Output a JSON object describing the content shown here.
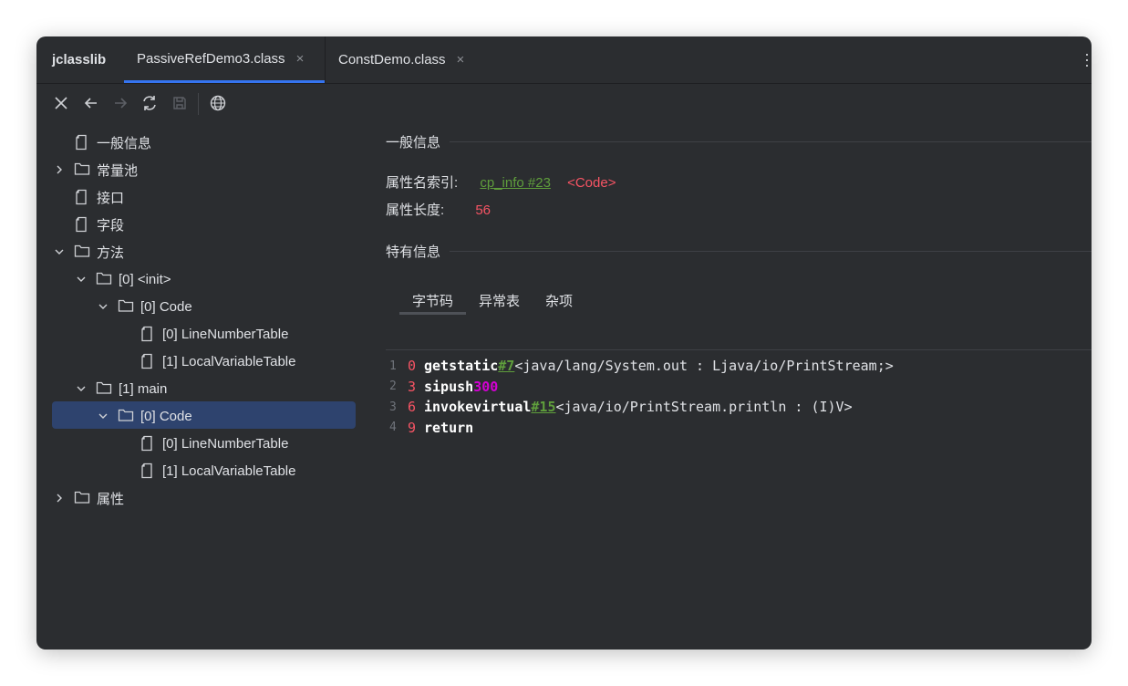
{
  "app": {
    "title": "jclasslib"
  },
  "tabs": [
    {
      "label": "PassiveRefDemo3.class",
      "close": "×",
      "active": true
    },
    {
      "label": "ConstDemo.class",
      "close": "×",
      "active": false
    }
  ],
  "toolbar": {
    "buttons": [
      "close-icon",
      "back-arrow-icon",
      "forward-arrow-icon",
      "refresh-icon",
      "save-icon",
      "globe-icon"
    ]
  },
  "tree": [
    {
      "label": "一般信息",
      "icon": "file-icon",
      "expanded": null
    },
    {
      "label": "常量池",
      "icon": "folder-icon",
      "expanded": false
    },
    {
      "label": "接口",
      "icon": "file-icon",
      "expanded": null
    },
    {
      "label": "字段",
      "icon": "file-icon",
      "expanded": null
    },
    {
      "label": "方法",
      "icon": "folder-icon",
      "expanded": true
    },
    {
      "label": "[0] <init>",
      "icon": "folder-icon",
      "expanded": true
    },
    {
      "label": "[0] Code",
      "icon": "folder-icon",
      "expanded": true
    },
    {
      "label": "[0] LineNumberTable",
      "icon": "file-icon",
      "expanded": null
    },
    {
      "label": "[1] LocalVariableTable",
      "icon": "file-icon",
      "expanded": null
    },
    {
      "label": "[1] main",
      "icon": "folder-icon",
      "expanded": true
    },
    {
      "label": "[0] Code",
      "icon": "folder-icon",
      "expanded": true,
      "selected": true
    },
    {
      "label": "[0] LineNumberTable",
      "icon": "file-icon",
      "expanded": null
    },
    {
      "label": "[1] LocalVariableTable",
      "icon": "file-icon",
      "expanded": null
    },
    {
      "label": "属性",
      "icon": "folder-icon",
      "expanded": false
    }
  ],
  "detail": {
    "general_title": "一般信息",
    "attr_name_label": "属性名索引:",
    "attr_name_link": "cp_info #23",
    "attr_name_value": "<Code>",
    "attr_len_label": "属性长度:",
    "attr_len_value": "56",
    "specific_title": "特有信息",
    "subtabs": [
      "字节码",
      "异常表",
      "杂项"
    ],
    "code": [
      {
        "line": "1",
        "offset": "0",
        "op": "getstatic",
        "ref": "#7",
        "arg": "<java/lang/System.out : Ljava/io/PrintStream;>"
      },
      {
        "line": "2",
        "offset": "3",
        "op": "sipush",
        "num": "300"
      },
      {
        "line": "3",
        "offset": "6",
        "op": "invokevirtual",
        "ref": "#15",
        "arg": "<java/io/PrintStream.println : (I)V>"
      },
      {
        "line": "4",
        "offset": "9",
        "op": "return"
      }
    ]
  },
  "colors": {
    "background": "#2b2d30",
    "selection": "#2e436e",
    "accent": "#3574f0",
    "link": "#5f9e3c",
    "value_red": "#f75464",
    "number": "#d400d4"
  }
}
